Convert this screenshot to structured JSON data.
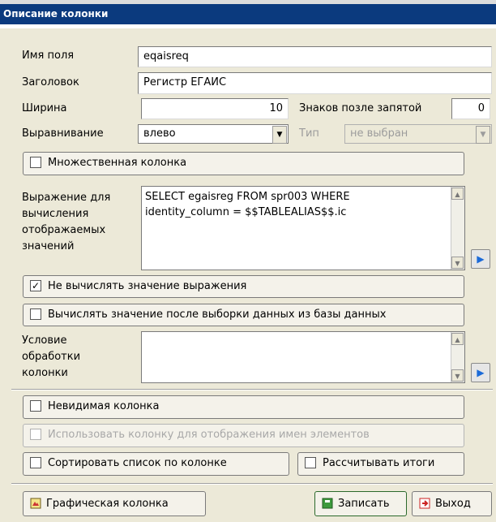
{
  "window": {
    "title": "Описание колонки"
  },
  "fields": {
    "name_label": "Имя поля",
    "name_value": "eqaisreq",
    "caption_label": "Заголовок",
    "caption_value": "Регистр ЕГАИС",
    "width_label": "Ширина",
    "width_value": "10",
    "decimals_label": "Знаков позле запятой",
    "decimals_value": "0",
    "align_label": "Выравнивание",
    "align_value": "влево",
    "type_label": "Тип",
    "type_value": "не выбран"
  },
  "checks": {
    "multiple": "Множественная колонка",
    "no_eval": "Не вычислять значение выражения",
    "eval_after": "Вычислять значение после выборки данных из базы данных",
    "invisible": "Невидимая колонка",
    "names_display": "Использовать колонку для отображения имен элементов",
    "sort": "Сортировать список по колонке",
    "totals": "Рассчитывать итоги"
  },
  "checked_marks": {
    "no_eval": "✓"
  },
  "expression": {
    "label_line1": "Выражение для",
    "label_line2": "вычисления",
    "label_line3": "отображаемых",
    "label_line4": "значений",
    "text_line1": "SELECT egaisreg FROM spr003 WHERE",
    "text_line2": "identity_column = $$TABLEALIAS$$.ic"
  },
  "condition": {
    "label_line1": "Условие",
    "label_line2": "обработки",
    "label_line3": "колонки",
    "text": ""
  },
  "footer": {
    "graphic": "Графическая колонка",
    "save": "Записать",
    "exit": "Выход"
  },
  "icons": [
    "dropdown-arrow-icon",
    "play-icon",
    "scroll-up-icon",
    "scroll-down-icon",
    "graphic-column-icon",
    "save-icon",
    "exit-icon"
  ],
  "colors": {
    "title_bg": "#0b3a7e",
    "dialog_bg": "#ece9d8",
    "accent_blue": "#1b6ad8"
  }
}
